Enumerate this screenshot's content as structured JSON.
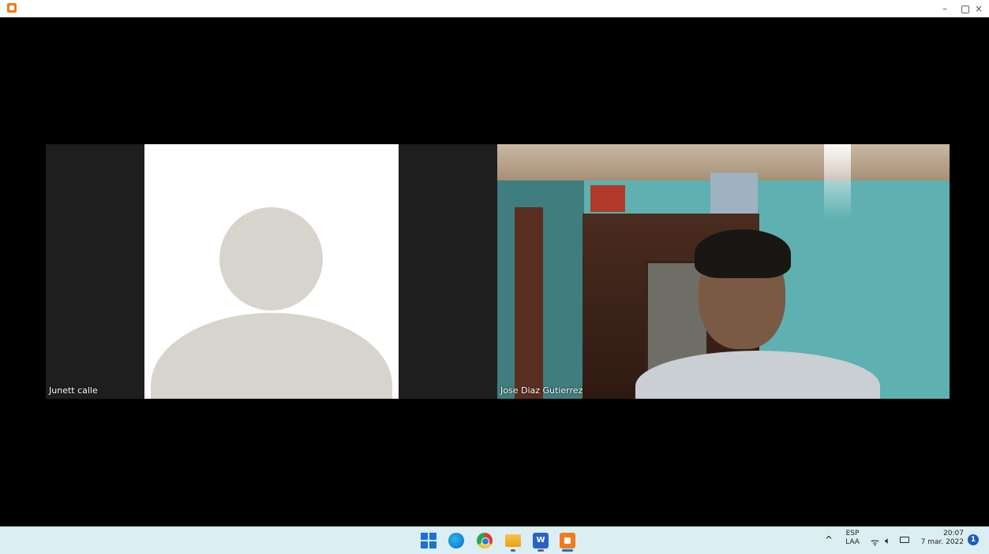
{
  "window": {
    "minimize_glyph": "–",
    "close_glyph": "×"
  },
  "participants": [
    {
      "name": "Junett calle",
      "video": false
    },
    {
      "name": "Jose Diaz Gutierrez",
      "video": true
    }
  ],
  "taskbar": {
    "apps": [
      "start-icon",
      "edge-icon",
      "chrome-icon",
      "file-explorer-icon",
      "word-icon",
      "meeting-app-icon"
    ],
    "tray": {
      "chevron_glyph": "^",
      "lang_top": "ESP",
      "lang_bottom": "LAA",
      "time": "20:07",
      "date": "7 mar. 2022",
      "notification_count": "1"
    }
  }
}
